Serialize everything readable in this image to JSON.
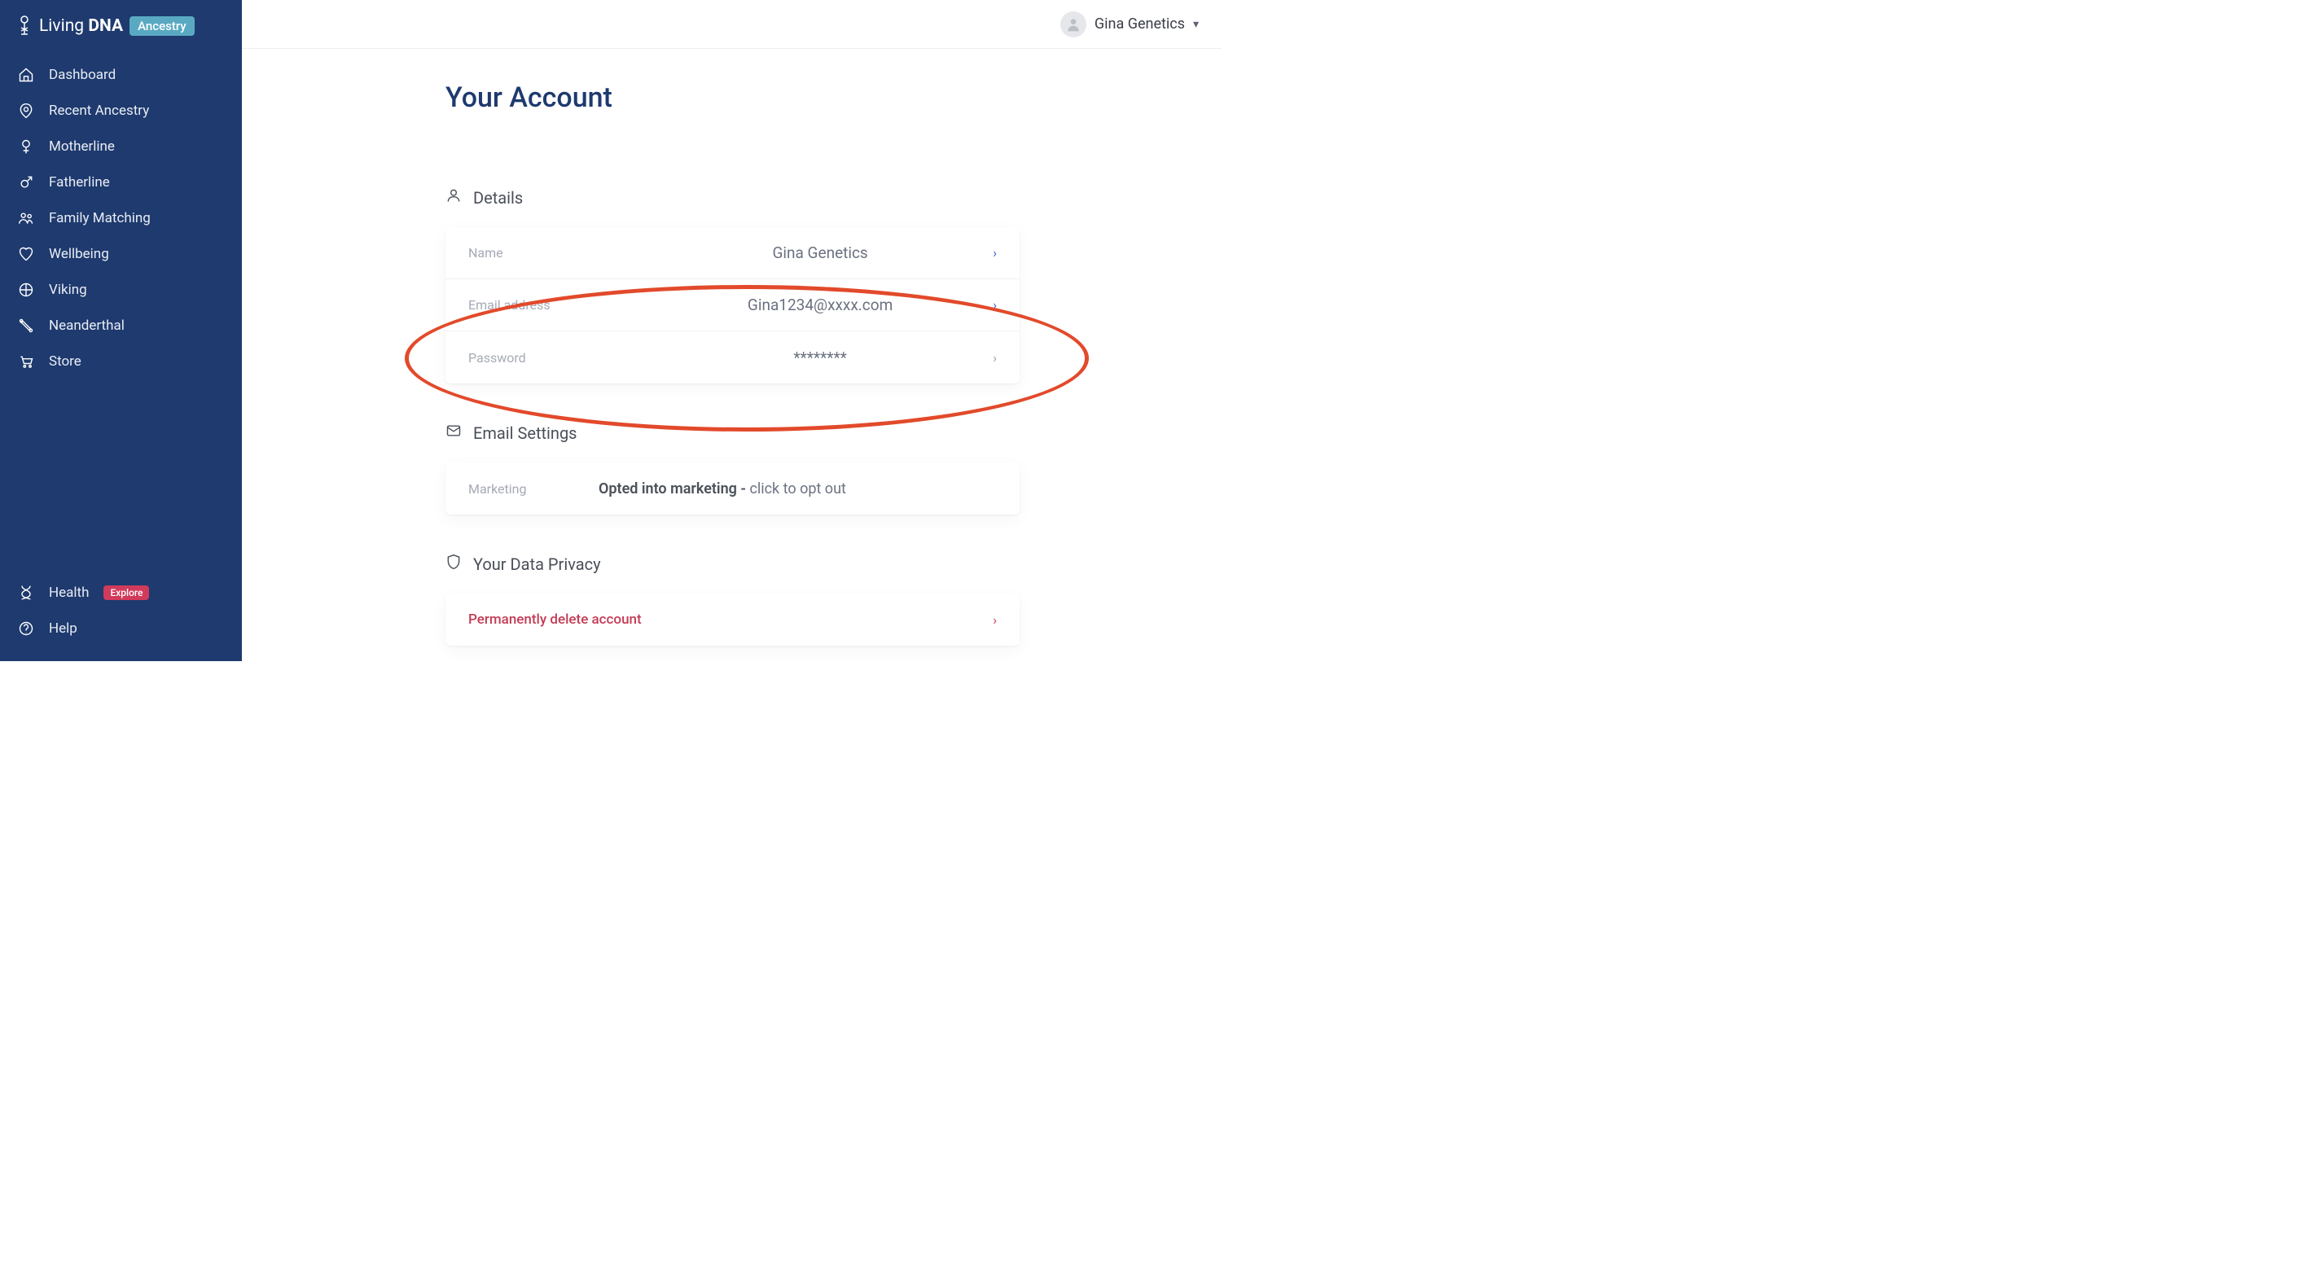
{
  "brand": {
    "name_light": "Living",
    "name_bold": "DNA",
    "badge": "Ancestry"
  },
  "sidebar": {
    "items": [
      {
        "label": "Dashboard"
      },
      {
        "label": "Recent Ancestry"
      },
      {
        "label": "Motherline"
      },
      {
        "label": "Fatherline"
      },
      {
        "label": "Family Matching"
      },
      {
        "label": "Wellbeing"
      },
      {
        "label": "Viking"
      },
      {
        "label": "Neanderthal"
      },
      {
        "label": "Store"
      }
    ],
    "bottom_items": [
      {
        "label": "Health",
        "badge": "Explore"
      },
      {
        "label": "Help"
      }
    ]
  },
  "topbar": {
    "user_name": "Gina Genetics"
  },
  "page": {
    "title": "Your Account",
    "details": {
      "heading": "Details",
      "rows": [
        {
          "label": "Name",
          "value": "Gina Genetics"
        },
        {
          "label": "Email address",
          "value": "Gina1234@xxxx.com"
        },
        {
          "label": "Password",
          "value": "********"
        }
      ]
    },
    "email_settings": {
      "heading": "Email Settings",
      "marketing_label": "Marketing",
      "marketing_bold": "Opted into marketing - ",
      "marketing_muted": "click to opt out"
    },
    "privacy": {
      "heading": "Your Data Privacy",
      "delete_label": "Permanently delete account"
    }
  }
}
